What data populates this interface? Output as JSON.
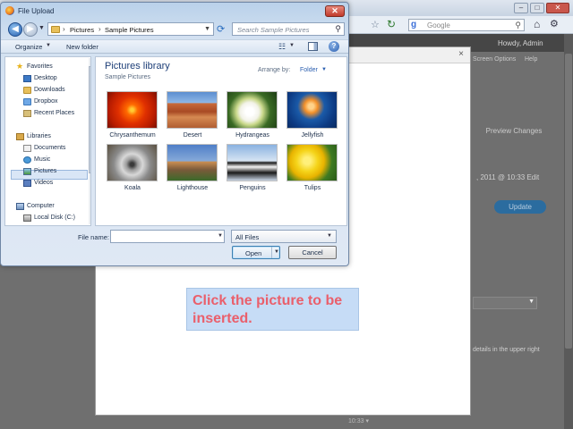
{
  "browser": {
    "search_engine_label": "Google",
    "howdy": "Howdy, Admin",
    "screen_options": "Screen Options",
    "help": "Help",
    "preview_changes": "Preview Changes",
    "date_text": ", 2011 @ 10:33 Edit",
    "update": "Update",
    "hint_text": "details in the upper right"
  },
  "modal": {
    "close_glyph": "×",
    "footer_text": "10:33 ▾",
    "callout": "Click the picture to be inserted."
  },
  "dialog": {
    "title": "File Upload",
    "close_glyph": "✕",
    "breadcrumb": [
      "Pictures",
      "Sample Pictures"
    ],
    "search_placeholder": "Search Sample Pictures",
    "toolbar": {
      "organize": "Organize",
      "new_folder": "New folder"
    },
    "nav": {
      "favorites": "Favorites",
      "desktop": "Desktop",
      "downloads": "Downloads",
      "dropbox": "Dropbox",
      "recent_places": "Recent Places",
      "libraries": "Libraries",
      "documents": "Documents",
      "music": "Music",
      "pictures": "Pictures",
      "videos": "Videos",
      "computer": "Computer",
      "local_disk": "Local Disk (C:)"
    },
    "library": {
      "title": "Pictures library",
      "subtitle": "Sample Pictures",
      "arrange_by": "Arrange by:",
      "arrange_value": "Folder"
    },
    "files": [
      {
        "name": "Chrysanthemum"
      },
      {
        "name": "Desert"
      },
      {
        "name": "Hydrangeas"
      },
      {
        "name": "Jellyfish"
      },
      {
        "name": "Koala"
      },
      {
        "name": "Lighthouse"
      },
      {
        "name": "Penguins"
      },
      {
        "name": "Tulips"
      }
    ],
    "file_name_label": "File name:",
    "file_name_value": "",
    "file_type": "All Files",
    "open": "Open",
    "cancel": "Cancel"
  }
}
